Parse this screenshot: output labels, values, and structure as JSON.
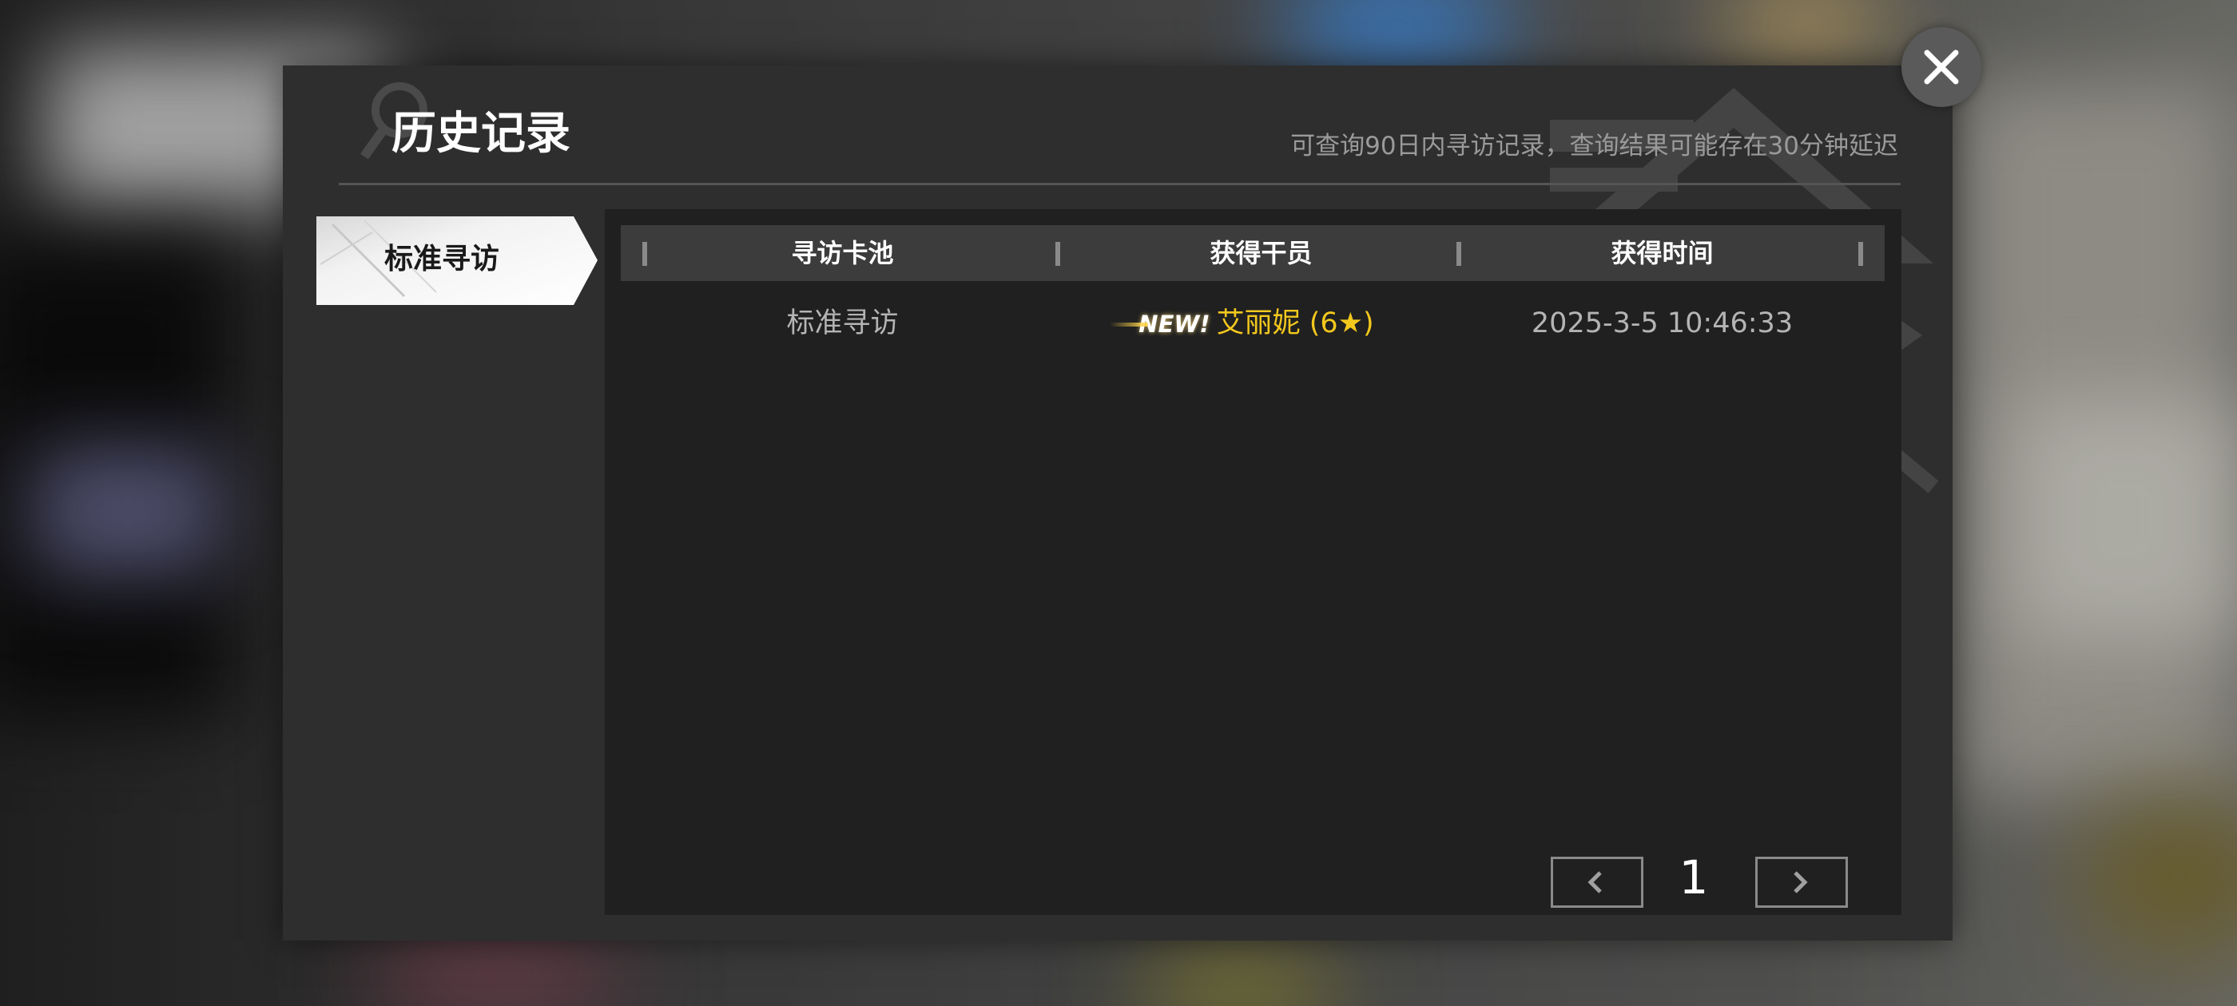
{
  "dialog": {
    "title": "历史记录",
    "hint": "可查询90日内寻访记录，查询结果可能存在30分钟延迟"
  },
  "tabs": [
    {
      "label": "标准寻访",
      "selected": true
    }
  ],
  "table": {
    "headers": [
      "寻访卡池",
      "获得干员",
      "获得时间"
    ],
    "rows": [
      {
        "pool": "标准寻访",
        "badge": "NEW!",
        "operator": "艾丽妮 (6★)",
        "time": "2025-3-5 10:46:33"
      }
    ]
  },
  "pagination": {
    "current_page": "1",
    "prev_icon": "chevron-left-icon",
    "next_icon": "chevron-right-icon"
  },
  "icons": {
    "close": "close-icon",
    "title_decoration": "magnifier-icon"
  },
  "colors": {
    "operator_six_star": "#f3c81d",
    "dialog_background": "#2e2e2e",
    "panel_background": "#202020"
  }
}
